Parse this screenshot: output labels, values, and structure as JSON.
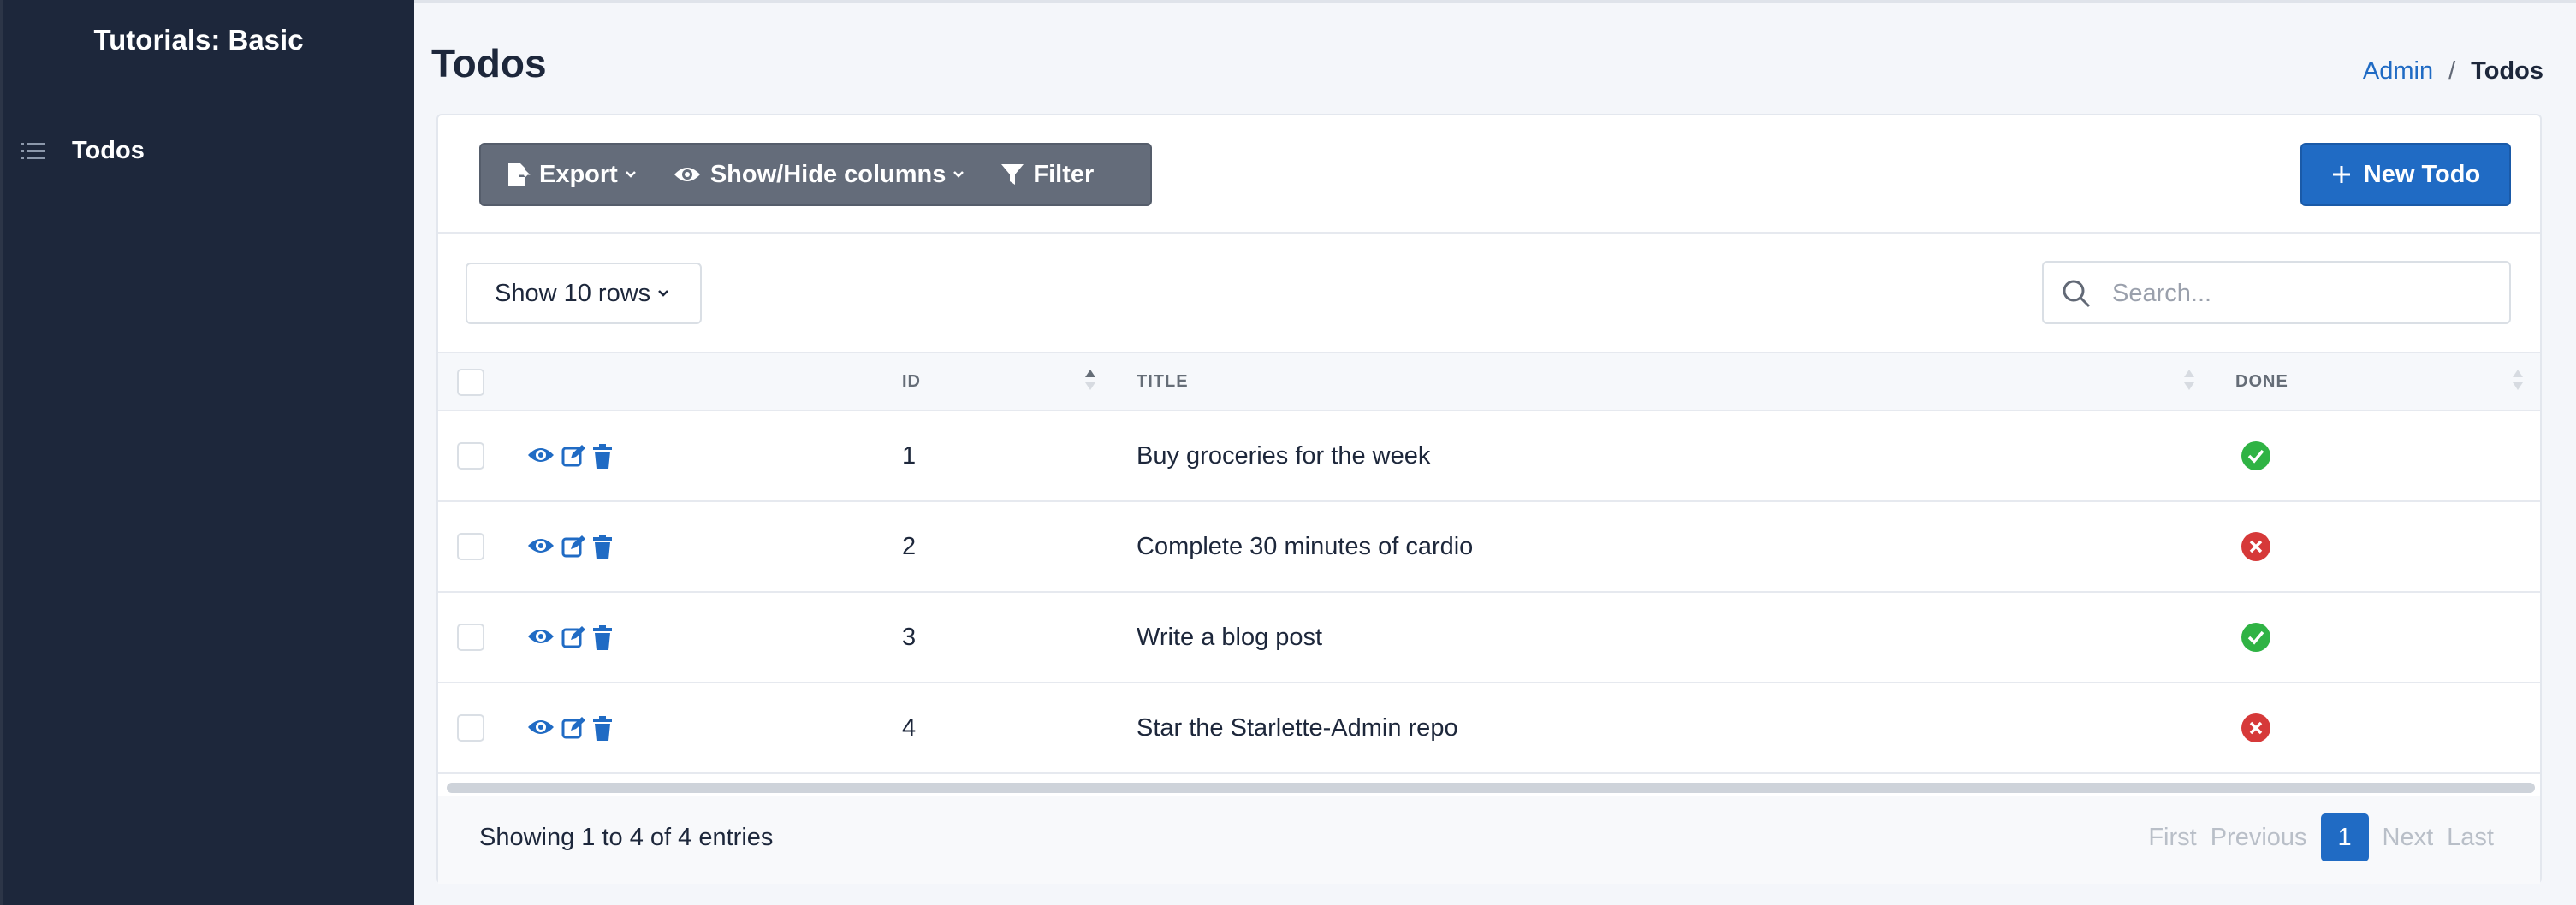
{
  "sidebar": {
    "brand": "Tutorials: Basic",
    "items": [
      {
        "label": "Todos",
        "icon": "list-icon"
      }
    ]
  },
  "header": {
    "title": "Todos",
    "breadcrumb": {
      "link": "Admin",
      "separator": "/",
      "current": "Todos"
    }
  },
  "toolbar": {
    "export_label": "Export",
    "columns_label": "Show/Hide columns",
    "filter_label": "Filter",
    "new_label": "New Todo"
  },
  "controls": {
    "rows_label": "Show 10 rows",
    "search_placeholder": "Search..."
  },
  "table": {
    "columns": {
      "id": "ID",
      "title": "TITLE",
      "done": "DONE"
    },
    "rows": [
      {
        "id": "1",
        "title": "Buy groceries for the week",
        "done": true
      },
      {
        "id": "2",
        "title": "Complete 30 minutes of cardio",
        "done": false
      },
      {
        "id": "3",
        "title": "Write a blog post",
        "done": true
      },
      {
        "id": "4",
        "title": "Star the Starlette-Admin repo",
        "done": false
      }
    ]
  },
  "footer": {
    "entries": "Showing 1 to 4 of 4 entries",
    "pager": {
      "first": "First",
      "previous": "Previous",
      "current": "1",
      "next": "Next",
      "last": "Last"
    }
  },
  "colors": {
    "primary": "#206bc4",
    "sidebar": "#1d273b",
    "success": "#2fb344",
    "danger": "#d63939"
  }
}
